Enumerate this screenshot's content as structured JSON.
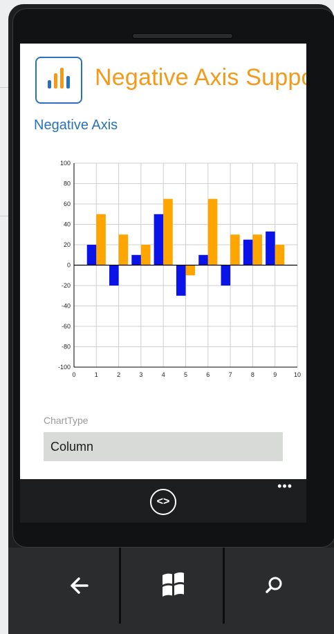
{
  "app": {
    "title": "Negative Axis Support",
    "page_heading": "Negative Axis",
    "logo_icon": "column-chart-logo-icon",
    "accent_color": "#f39a1b",
    "brand_color": "#2872b7"
  },
  "chart_type_field": {
    "label": "ChartType",
    "value": "Column"
  },
  "app_bar": {
    "center_icon": "code-brackets-icon",
    "more_label": "•••"
  },
  "hardware_buttons": [
    "back-arrow-icon",
    "windows-logo-icon",
    "search-icon"
  ],
  "chart_data": {
    "type": "bar",
    "x": [
      1,
      2,
      3,
      4,
      5,
      6,
      7,
      8,
      9
    ],
    "xlim": [
      0,
      10
    ],
    "ylim": [
      -100,
      100
    ],
    "x_ticks": [
      0,
      1,
      2,
      3,
      4,
      5,
      6,
      7,
      8,
      9,
      10
    ],
    "y_ticks": [
      100,
      80,
      60,
      40,
      20,
      0,
      -20,
      -40,
      -60,
      -80,
      -100
    ],
    "grid": true,
    "series": [
      {
        "color": "#0a14e8",
        "values": [
          20,
          -20,
          10,
          50,
          -30,
          10,
          -20,
          25,
          33
        ]
      },
      {
        "color": "#ffa500",
        "values": [
          50,
          30,
          20,
          65,
          -10,
          65,
          30,
          30,
          20
        ]
      }
    ]
  }
}
